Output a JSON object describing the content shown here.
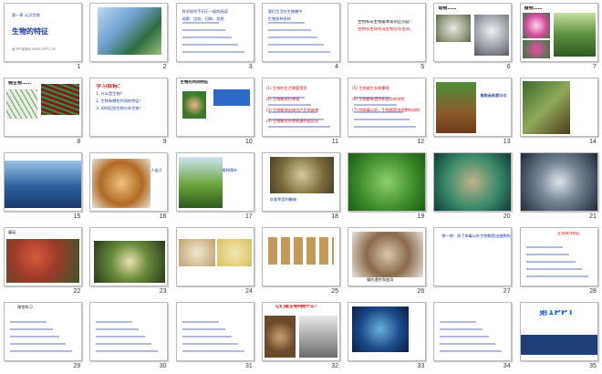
{
  "slides": [
    {
      "num": "1",
      "lines": [
        "第一章  认识生物",
        "生物的特征",
        "第1PPT模板网 WWW.1PPT.COM"
      ]
    },
    {
      "num": "2",
      "lines": []
    },
    {
      "num": "3",
      "lines": [
        "科学探究不同于一般的阅读",
        "观察、比较、归纳、总结"
      ]
    },
    {
      "num": "4",
      "lines": [
        "我们生活在生物圈中",
        "生物多种多样"
      ]
    },
    {
      "num": "5",
      "lines": [
        "生物和非生物最本质的区别是：",
        "生物有生命而非生物没有生命。"
      ]
    },
    {
      "num": "6",
      "lines": [
        "动物……"
      ]
    },
    {
      "num": "7",
      "lines": [
        "植物……"
      ]
    },
    {
      "num": "8",
      "lines": [
        "微生物……"
      ]
    },
    {
      "num": "9",
      "lines": [
        "学习目标：",
        "1. 什么是生物？",
        "2. 生物有哪些共同的特征？",
        "3. 如何区别生物与非生物？"
      ]
    },
    {
      "num": "10",
      "lines": [
        "生物的共同特征"
      ]
    },
    {
      "num": "11",
      "lines": [
        "(1) 生物的生活需要营养",
        "(2) 生物能进行呼吸",
        "(3) 生物能排出体内产生的废物",
        "(4) 生物能对外界刺激作出反应"
      ]
    },
    {
      "num": "12",
      "lines": [
        "(5) 生物能生长和繁殖",
        "(6) 生物都有遗传和变异的特性",
        "(7) 除病毒以外，生物都是由细胞构成的"
      ]
    },
    {
      "num": "13",
      "lines": [
        "植物从外界吸收",
        "水和无机盐"
      ]
    },
    {
      "num": "14",
      "lines": []
    },
    {
      "num": "15",
      "lines": [
        "鲸在呼气时产生雾状水柱"
      ]
    },
    {
      "num": "16",
      "lines": [
        "人出汗"
      ]
    },
    {
      "num": "17",
      "lines": [
        "植物落叶"
      ]
    },
    {
      "num": "18",
      "lines": [
        "含羞草受到触碰"
      ]
    },
    {
      "num": "19",
      "lines": []
    },
    {
      "num": "20",
      "lines": []
    },
    {
      "num": "21",
      "lines": []
    },
    {
      "num": "22",
      "lines": [
        "蘑菇"
      ]
    },
    {
      "num": "23",
      "lines": []
    },
    {
      "num": "24",
      "lines": []
    },
    {
      "num": "25",
      "lines": []
    },
    {
      "num": "26",
      "lines": [
        "猫的遗传和变异"
      ]
    },
    {
      "num": "27",
      "lines": [
        "想一想：除了病毒以外生物都是由细胞构成的吗？"
      ]
    },
    {
      "num": "28",
      "lines": [
        "生物的特征"
      ]
    },
    {
      "num": "29",
      "lines": [
        "课堂练习"
      ]
    },
    {
      "num": "30",
      "lines": []
    },
    {
      "num": "31",
      "lines": []
    },
    {
      "num": "32",
      "lines": [
        "它们是生物吗？",
        "为什么？"
      ]
    },
    {
      "num": "33",
      "lines": []
    },
    {
      "num": "34",
      "lines": []
    },
    {
      "num": "35",
      "lines": [
        "第1PPT"
      ]
    }
  ],
  "colors": {
    "accent": "#1d3a9e",
    "red": "#d01818",
    "frame": "#b9b9b9"
  }
}
